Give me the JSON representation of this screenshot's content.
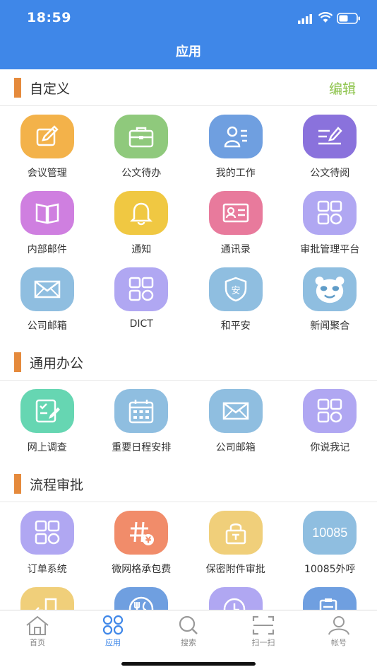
{
  "status": {
    "time": "18:59"
  },
  "nav": {
    "title": "应用"
  },
  "sections": {
    "custom": {
      "title": "自定义",
      "edit": "编辑",
      "items": [
        "会议管理",
        "公文待办",
        "我的工作",
        "公文待阅",
        "内部邮件",
        "通知",
        "通讯录",
        "审批管理平台",
        "公司邮箱",
        "DICT",
        "和平安",
        "新闻聚合"
      ]
    },
    "office": {
      "title": "通用办公",
      "items": [
        "网上调查",
        "重要日程安排",
        "公司邮箱",
        "你说我记"
      ]
    },
    "flow": {
      "title": "流程审批",
      "items": [
        "订单系统",
        "微网格承包费",
        "保密附件审批",
        "10085外呼"
      ],
      "number_icon": "10085",
      "yen_glyph": "¥",
      "shield_glyph": "安"
    }
  },
  "tabs": [
    "首页",
    "应用",
    "搜索",
    "扫一扫",
    "帐号"
  ],
  "colors": {
    "primary": "#3f87e8",
    "accent_bar": "#e58a3c",
    "edit": "#8cc34a",
    "orange": "#f3b24a",
    "green": "#8fc97c",
    "blue": "#6f9fe0",
    "purple": "#8a72dc",
    "magenta": "#cf7fe0",
    "yellow": "#f0c842",
    "pink": "#e87a9c",
    "lavender": "#b0a7f2",
    "skyblue": "#8fbee0",
    "teal": "#66d6b2",
    "salmon": "#f18c6a",
    "sand": "#f0cf7a"
  }
}
